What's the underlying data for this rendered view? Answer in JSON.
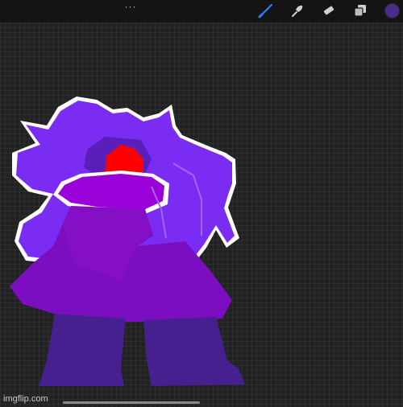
{
  "toolbar": {
    "more_label": "···",
    "tools": [
      {
        "name": "brush-icon",
        "active": true
      },
      {
        "name": "smudge-icon",
        "active": false
      },
      {
        "name": "eraser-icon",
        "active": false
      },
      {
        "name": "layers-icon",
        "active": false
      }
    ],
    "current_color": "#4b2a8c",
    "accent_color": "#2f7bff"
  },
  "watermark": "imgflip.com"
}
